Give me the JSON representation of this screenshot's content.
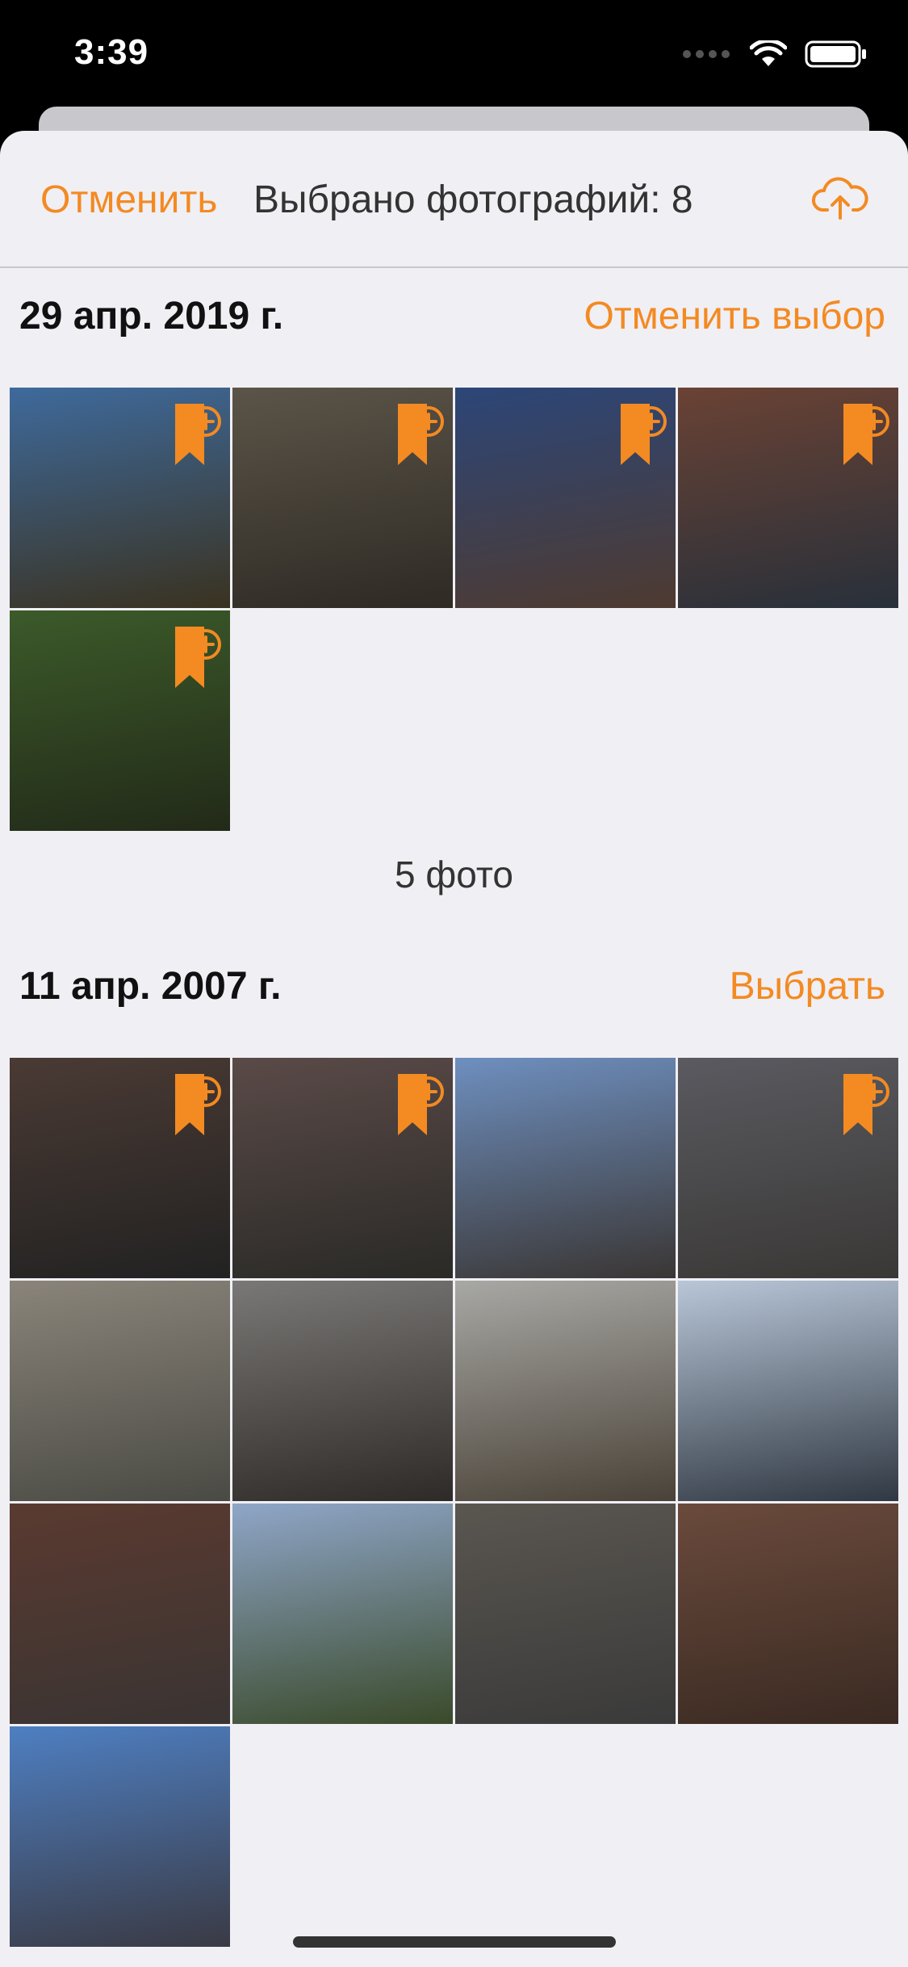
{
  "status": {
    "time": "3:39"
  },
  "nav": {
    "cancel_label": "Отменить",
    "title": "Выбрано фотографий: 8",
    "upload_icon": "cloud-upload-icon"
  },
  "colors": {
    "accent": "#f38a22",
    "sheet_bg": "#f0eff4"
  },
  "sections": [
    {
      "date": "29 апр. 2019 г.",
      "action_label": "Отменить выбор",
      "count_label": "5 фото",
      "photos": [
        {
          "badge": true,
          "c1": "#3e6a9c",
          "c2": "#3a3220"
        },
        {
          "badge": true,
          "c1": "#5b5448",
          "c2": "#2e2a24"
        },
        {
          "badge": true,
          "c1": "#2c4678",
          "c2": "#4e3a30"
        },
        {
          "badge": true,
          "c1": "#6a4234",
          "c2": "#28303a"
        },
        {
          "badge": true,
          "c1": "#3c5a2a",
          "c2": "#222a18"
        }
      ]
    },
    {
      "date": "11 апр. 2007 г.",
      "action_label": "Выбрать",
      "photos": [
        {
          "badge": true,
          "c1": "#4a3a34",
          "c2": "#222222"
        },
        {
          "badge": true,
          "c1": "#5a4a48",
          "c2": "#2a2a26"
        },
        {
          "badge": false,
          "c1": "#6e8fbf",
          "c2": "#3a3634"
        },
        {
          "badge": true,
          "c1": "#5a5a60",
          "c2": "#3a3836"
        },
        {
          "badge": false,
          "c1": "#8a847a",
          "c2": "#4a4a44"
        },
        {
          "badge": false,
          "c1": "#7a7876",
          "c2": "#2e2a28"
        },
        {
          "badge": false,
          "c1": "#a8a8a4",
          "c2": "#4a4238"
        },
        {
          "badge": false,
          "c1": "#b8c6d8",
          "c2": "#303842"
        },
        {
          "badge": false,
          "c1": "#5a3a30",
          "c2": "#3a3432"
        },
        {
          "badge": false,
          "c1": "#8fa6c8",
          "c2": "#3a4a2a"
        },
        {
          "badge": false,
          "c1": "#5a5650",
          "c2": "#3a3a3a"
        },
        {
          "badge": false,
          "c1": "#6a4a3c",
          "c2": "#3a2a22"
        },
        {
          "badge": false,
          "c1": "#4e7fc2",
          "c2": "#3a3a44"
        }
      ]
    }
  ]
}
